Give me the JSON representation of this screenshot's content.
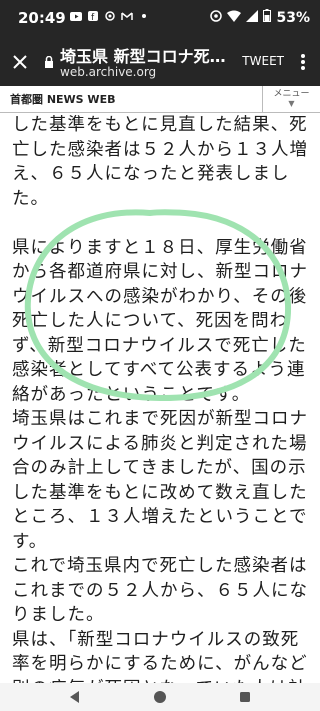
{
  "status": {
    "time": "20:49",
    "battery": "53%"
  },
  "browser": {
    "title": "埼玉県 新型コロナ死…",
    "url": "web.archive.org",
    "tweet_label": "TWEET"
  },
  "site": {
    "logo": "首都圏 NEWS WEB",
    "menu_label": "メニュー"
  },
  "article": {
    "paragraphs": [
      "した基準をもとに見直した結果、死亡した感染者は５２人から１３人増え、６５人になったと発表しました。",
      "",
      "県によりますと１８日、厚生労働省から各都道府県に対し、新型コロナウイルスへの感染がわかり、その後死亡した人について、死因を問わず、新型コロナウイルスで死亡した感染者としてすべて公表するよう連絡があったということです。",
      "埼玉県はこれまで死因が新型コロナウイルスによる肺炎と判定された場合のみ計上してきましたが、国の示した基準をもとに改めて数え直したところ、１３人増えたということです。",
      "これで埼玉県内で死亡した感染者はこれまでの５２人から、６５人になりました。",
      "県は、「新型コロナウイルスの致死率を明らかにするために、がんなど別の病気が死因となっていた人は計上していませんでした"
    ]
  },
  "colors": {
    "bar": "#262626",
    "circle": "#9fe3b0"
  },
  "icons": [
    "youtube-icon",
    "facebook-icon",
    "settings-icon",
    "gmail-icon",
    "wifi-icon",
    "battery-icon"
  ]
}
